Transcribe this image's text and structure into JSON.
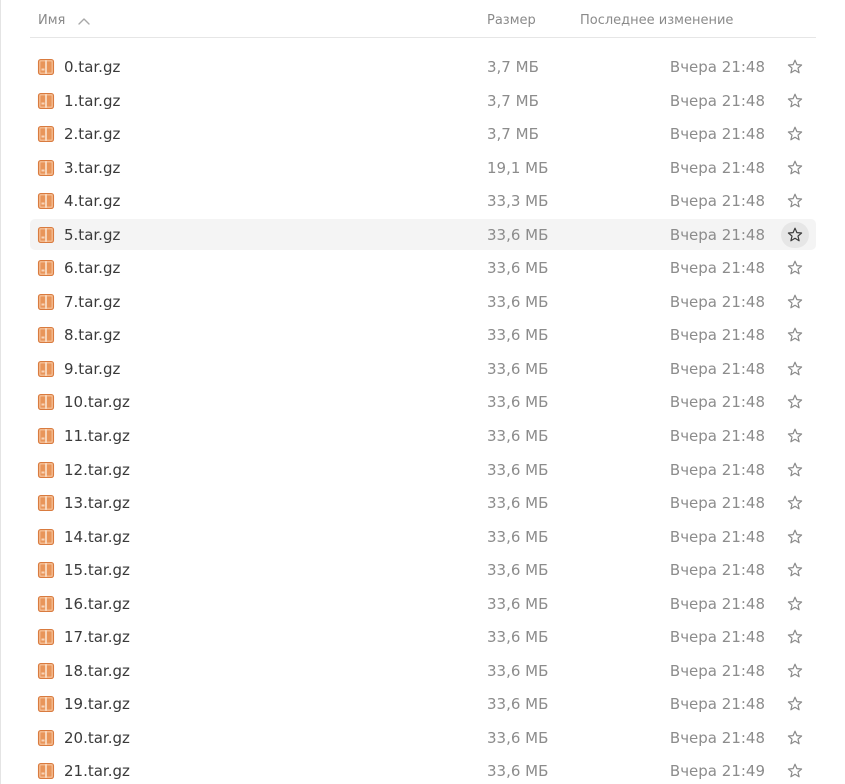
{
  "columns": {
    "name": "Имя",
    "size": "Размер",
    "modified": "Последнее изменение"
  },
  "icons": {
    "sort": "chevron-up-icon",
    "file": "archive-icon",
    "star": "star-outline-icon"
  },
  "colors": {
    "archive_orange": "#e8955a",
    "archive_light": "#f3b98d",
    "hover_row": "#f4f4f4",
    "star_hover": "#e6e6e6"
  },
  "files": [
    {
      "name": "0.tar.gz",
      "size": "3,7 МБ",
      "modified": "Вчера 21:48"
    },
    {
      "name": "1.tar.gz",
      "size": "3,7 МБ",
      "modified": "Вчера 21:48"
    },
    {
      "name": "2.tar.gz",
      "size": "3,7 МБ",
      "modified": "Вчера 21:48"
    },
    {
      "name": "3.tar.gz",
      "size": "19,1 МБ",
      "modified": "Вчера 21:48"
    },
    {
      "name": "4.tar.gz",
      "size": "33,3 МБ",
      "modified": "Вчера 21:48"
    },
    {
      "name": "5.tar.gz",
      "size": "33,6 МБ",
      "modified": "Вчера 21:48",
      "hover": true
    },
    {
      "name": "6.tar.gz",
      "size": "33,6 МБ",
      "modified": "Вчера 21:48"
    },
    {
      "name": "7.tar.gz",
      "size": "33,6 МБ",
      "modified": "Вчера 21:48"
    },
    {
      "name": "8.tar.gz",
      "size": "33,6 МБ",
      "modified": "Вчера 21:48"
    },
    {
      "name": "9.tar.gz",
      "size": "33,6 МБ",
      "modified": "Вчера 21:48"
    },
    {
      "name": "10.tar.gz",
      "size": "33,6 МБ",
      "modified": "Вчера 21:48"
    },
    {
      "name": "11.tar.gz",
      "size": "33,6 МБ",
      "modified": "Вчера 21:48"
    },
    {
      "name": "12.tar.gz",
      "size": "33,6 МБ",
      "modified": "Вчера 21:48"
    },
    {
      "name": "13.tar.gz",
      "size": "33,6 МБ",
      "modified": "Вчера 21:48"
    },
    {
      "name": "14.tar.gz",
      "size": "33,6 МБ",
      "modified": "Вчера 21:48"
    },
    {
      "name": "15.tar.gz",
      "size": "33,6 МБ",
      "modified": "Вчера 21:48"
    },
    {
      "name": "16.tar.gz",
      "size": "33,6 МБ",
      "modified": "Вчера 21:48"
    },
    {
      "name": "17.tar.gz",
      "size": "33,6 МБ",
      "modified": "Вчера 21:48"
    },
    {
      "name": "18.tar.gz",
      "size": "33,6 МБ",
      "modified": "Вчера 21:48"
    },
    {
      "name": "19.tar.gz",
      "size": "33,6 МБ",
      "modified": "Вчера 21:48"
    },
    {
      "name": "20.tar.gz",
      "size": "33,6 МБ",
      "modified": "Вчера 21:48"
    },
    {
      "name": "21.tar.gz",
      "size": "33,6 МБ",
      "modified": "Вчера 21:49"
    }
  ]
}
